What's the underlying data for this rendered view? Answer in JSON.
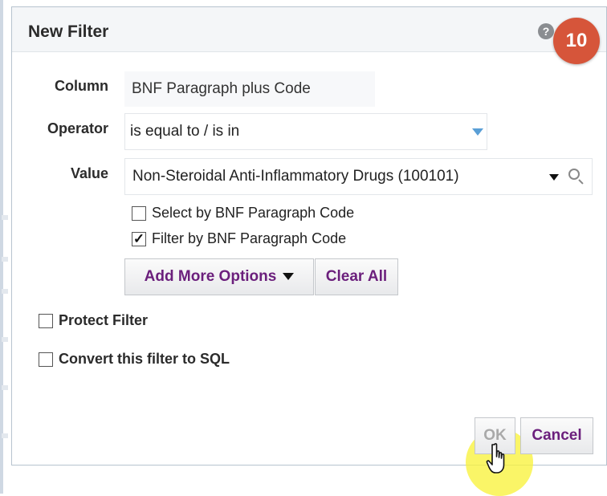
{
  "dialog": {
    "title": "New Filter",
    "help_symbol": "?",
    "step_badge": "10"
  },
  "form": {
    "column_label": "Column",
    "column_value": "BNF Paragraph plus Code",
    "operator_label": "Operator",
    "operator_value": "is equal to / is in",
    "value_label": "Value",
    "value_value": "Non-Steroidal Anti-Inflammatory Drugs (100101)"
  },
  "options": {
    "select_by_code": {
      "label": "Select by BNF Paragraph Code",
      "checked": false,
      "mark": ""
    },
    "filter_by_code": {
      "label": "Filter by BNF Paragraph Code",
      "checked": true,
      "mark": "✓"
    }
  },
  "buttons": {
    "add_more_options": "Add More Options",
    "clear_all": "Clear All",
    "ok": "OK",
    "cancel": "Cancel"
  },
  "footer_options": {
    "protect_filter": {
      "label": "Protect Filter",
      "checked": false
    },
    "convert_to_sql": {
      "label": "Convert this filter to SQL",
      "checked": false
    }
  },
  "colors": {
    "accent_purple": "#6b1f7c",
    "badge_red": "#d6553a",
    "highlight_yellow": "#f8f23c",
    "dropdown_blue": "#5a9fd6"
  }
}
